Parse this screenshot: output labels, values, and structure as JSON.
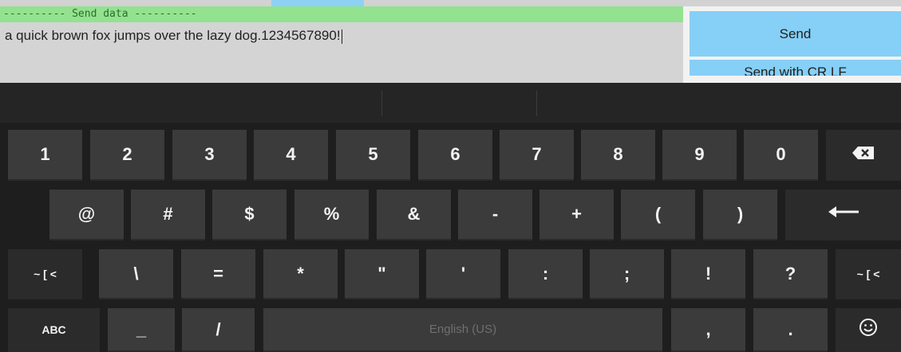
{
  "send_data": {
    "header": "---------- Send data ----------",
    "text": "a quick brown fox jumps over the lazy dog.1234567890!"
  },
  "buttons": {
    "send": "Send",
    "send_crlf": "Send with CR LF"
  },
  "keyboard": {
    "row1": [
      "1",
      "2",
      "3",
      "4",
      "5",
      "6",
      "7",
      "8",
      "9",
      "0"
    ],
    "row2": [
      "@",
      "#",
      "$",
      "%",
      "&",
      "-",
      "+",
      "(",
      ")"
    ],
    "row3_left": "~ [ <",
    "row3": [
      "\\",
      "=",
      "*",
      "\"",
      "'",
      ":",
      ";",
      "!",
      "?"
    ],
    "row3_right": "~ [ <",
    "row4": {
      "abc": "ABC",
      "underscore": "_",
      "slash": "/",
      "space_label": "English (US)",
      "comma": ",",
      "period": "."
    }
  },
  "colors": {
    "accent_button": "#86cff6",
    "send_header": "#93e28f",
    "key": "#3b3b3b",
    "keyboard_bg": "#1e1e1e"
  },
  "icons": [
    "backspace-icon",
    "enter-arrow-icon",
    "smiley-icon"
  ]
}
